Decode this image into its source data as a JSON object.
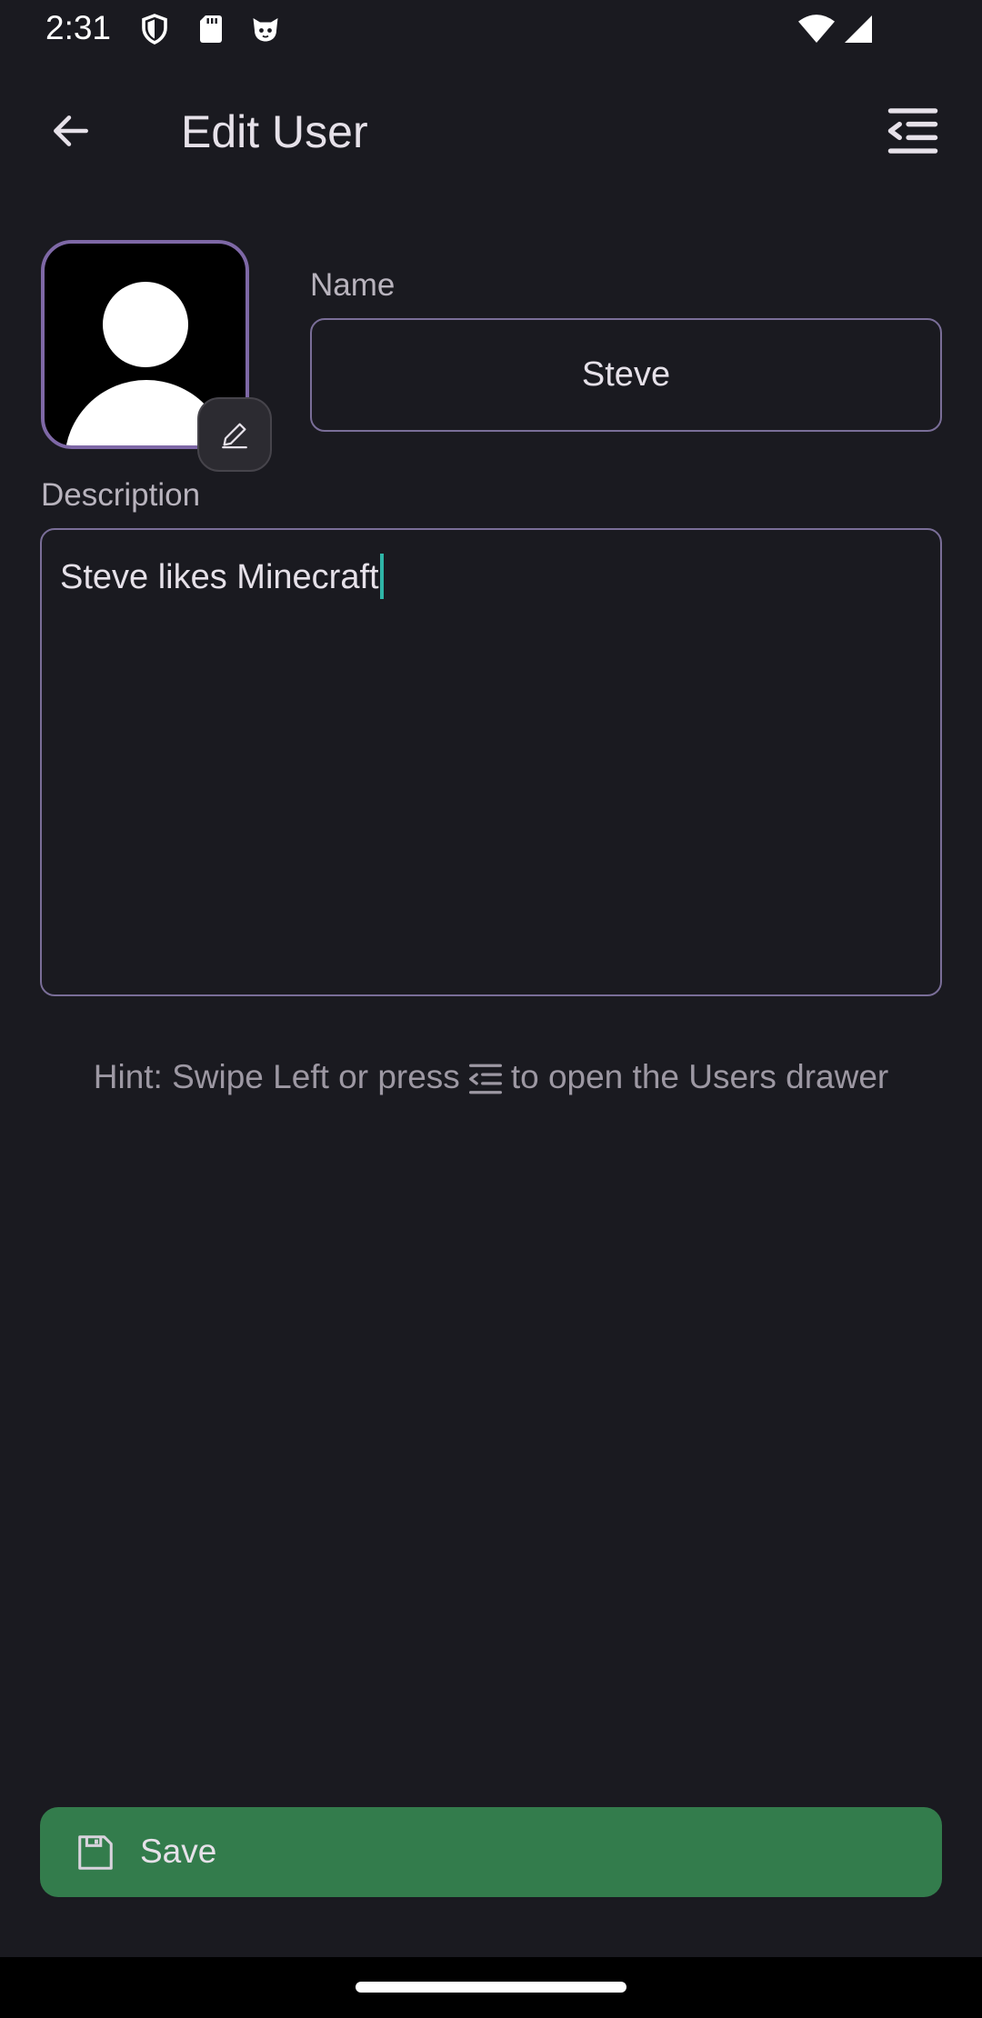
{
  "status_bar": {
    "time": "2:31",
    "icons": [
      "shield-icon",
      "sd-card-icon",
      "cat-face-icon",
      "wifi-icon",
      "cellular-signal-icon"
    ]
  },
  "app_bar": {
    "title": "Edit User",
    "back_icon": "arrow-back-icon",
    "drawer_icon": "menu-open-icon"
  },
  "avatar": {
    "edit_icon": "pencil-icon"
  },
  "form": {
    "name_label": "Name",
    "name_value": "Steve",
    "description_label": "Description",
    "description_value": "Steve likes Minecraft"
  },
  "hint": {
    "prefix": "Hint: Swipe Left or press",
    "suffix": "to open the Users drawer",
    "icon": "menu-open-icon"
  },
  "save_button": {
    "label": "Save",
    "icon": "save-icon",
    "color": "#337c4c"
  },
  "colors": {
    "background": "#1a1a20",
    "outline": "#7a6e98",
    "avatar_border": "#7e68a6",
    "caret": "#2fb5a7"
  }
}
